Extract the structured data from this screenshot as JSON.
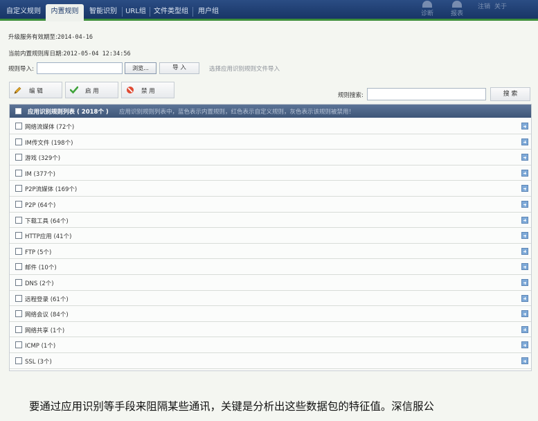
{
  "nav": {
    "tabs": [
      "自定义规则",
      "内置规则",
      "智能识别",
      "URL组",
      "文件类型组",
      "用户组"
    ],
    "active_tab": "内置规则",
    "right_icons": [
      "诊断",
      "报表"
    ],
    "right_links": [
      "注销",
      "关于"
    ]
  },
  "info": {
    "service_label": "升级服务有效期至:",
    "service_value": "2014-04-16",
    "lib_label": "当前内置规则库日期:",
    "lib_value": "2012-05-04 12:34:56"
  },
  "import": {
    "label": "规则导入:",
    "input_value": "",
    "browse_label": "浏览...",
    "import_label": "导 入",
    "hint": "选择应用识别规则文件导入"
  },
  "toolbar": {
    "edit_label": "编 辑",
    "enable_label": "启 用",
    "disable_label": "禁 用",
    "search_label": "规则搜索:",
    "search_value": "",
    "search_button": "搜 索"
  },
  "table": {
    "title": "应用识别规则列表 ( 2018个 )",
    "hint": "应用识别规则列表中，蓝色表示内置规则，红色表示自定义规则，灰色表示该规则被禁用！",
    "rows": [
      "网络流媒体 (72个)",
      "IM传文件 (198个)",
      "游戏 (329个)",
      "IM (377个)",
      "P2P流媒体 (169个)",
      "P2P (64个)",
      "下载工具 (64个)",
      "HTTP应用 (41个)",
      "FTP (5个)",
      "邮件 (10个)",
      "DNS (2个)",
      "远程登录 (61个)",
      "网络会议 (84个)",
      "网络共享 (1个)",
      "ICMP (1个)",
      "SSL (3个)",
      ""
    ]
  },
  "caption": "要通过应用识别等手段来阻隔某些通讯，关键是分析出这些数据包的特征值。深信服公",
  "colors": {
    "nav_bg": "#1f3f73",
    "nav_underline": "#3d8e3a",
    "table_header": "#4a6284",
    "expand_icon": "#7faad8"
  }
}
